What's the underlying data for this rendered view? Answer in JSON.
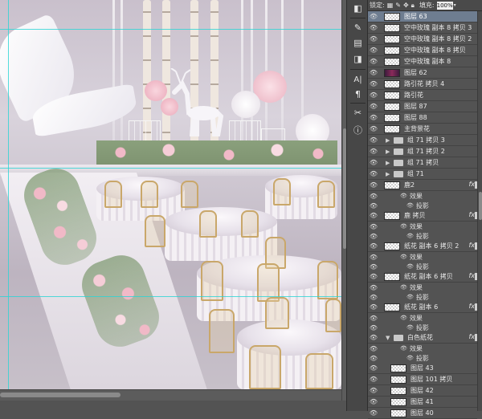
{
  "lock_bar": {
    "lock_label": "锁定:",
    "fill_label": "填充:",
    "fill_value": "100%",
    "icons": [
      "transparency-lock-icon",
      "brush-lock-icon",
      "move-lock-icon",
      "all-lock-icon"
    ]
  },
  "toolbar": {
    "icons": [
      "layers-panel-icon",
      "brush-tool-icon",
      "history-icon",
      "adjustments-icon",
      "image-icon",
      "character-icon",
      "paragraph-icon",
      "tools-icon",
      "info-icon"
    ]
  },
  "layers": [
    {
      "type": "layer",
      "name": "图层 63",
      "selected": true,
      "thumb": "blank"
    },
    {
      "type": "layer",
      "name": "空中玫瑰 副本 8 拷贝 3",
      "thumb": "blank"
    },
    {
      "type": "layer",
      "name": "空中玫瑰 副本 8 拷贝 2",
      "thumb": "blank"
    },
    {
      "type": "layer",
      "name": "空中玫瑰 副本 8 拷贝",
      "thumb": "blank"
    },
    {
      "type": "layer",
      "name": "空中玫瑰 副本 8",
      "thumb": "blank"
    },
    {
      "type": "layer",
      "name": "图层 62",
      "thumb": "dark"
    },
    {
      "type": "layer",
      "name": "路引花 拷贝 4",
      "thumb": "blank"
    },
    {
      "type": "layer",
      "name": "路引花",
      "thumb": "blank"
    },
    {
      "type": "layer",
      "name": "图层 87",
      "thumb": "blank"
    },
    {
      "type": "layer",
      "name": "图层 88",
      "thumb": "blank"
    },
    {
      "type": "layer",
      "name": "主背景花",
      "thumb": "blank"
    },
    {
      "type": "group",
      "name": "组 71 拷贝 3"
    },
    {
      "type": "group",
      "name": "组 71 拷贝 2"
    },
    {
      "type": "group",
      "name": "组 71 拷贝"
    },
    {
      "type": "group",
      "name": "组 71"
    },
    {
      "type": "layer",
      "name": "鹿2",
      "fx": "fx",
      "thumb": "blank"
    },
    {
      "type": "sub",
      "name": "效果",
      "indent": 1
    },
    {
      "type": "sub",
      "name": "投影",
      "indent": 2
    },
    {
      "type": "layer",
      "name": "鹿 拷贝",
      "fx": "fx",
      "thumb": "blank"
    },
    {
      "type": "sub",
      "name": "效果",
      "indent": 1
    },
    {
      "type": "sub",
      "name": "投影",
      "indent": 2
    },
    {
      "type": "layer",
      "name": "纸花 副本 6 拷贝 2",
      "fx": "fx",
      "thumb": "blank"
    },
    {
      "type": "sub",
      "name": "效果",
      "indent": 1
    },
    {
      "type": "sub",
      "name": "投影",
      "indent": 2
    },
    {
      "type": "layer",
      "name": "纸花 副本 6 拷贝",
      "fx": "fx",
      "thumb": "blank"
    },
    {
      "type": "sub",
      "name": "效果",
      "indent": 1
    },
    {
      "type": "sub",
      "name": "投影",
      "indent": 2
    },
    {
      "type": "layer",
      "name": "纸花 副本 6",
      "fx": "fx",
      "thumb": "blank"
    },
    {
      "type": "sub",
      "name": "效果",
      "indent": 1
    },
    {
      "type": "sub",
      "name": "投影",
      "indent": 2
    },
    {
      "type": "group-open",
      "name": "白色纸花",
      "fx": "fx"
    },
    {
      "type": "sub",
      "name": "效果",
      "indent": 1
    },
    {
      "type": "sub",
      "name": "投影",
      "indent": 2
    },
    {
      "type": "layer",
      "name": "图层 43",
      "indent": 1,
      "thumb": "blank"
    },
    {
      "type": "layer",
      "name": "图层 101 拷贝",
      "indent": 1,
      "thumb": "blank"
    },
    {
      "type": "layer",
      "name": "图层 42",
      "indent": 1,
      "thumb": "blank"
    },
    {
      "type": "layer",
      "name": "图层 41",
      "indent": 1,
      "thumb": "blank"
    },
    {
      "type": "layer",
      "name": "图层 40",
      "indent": 1,
      "thumb": "blank"
    }
  ],
  "colors": {
    "guide": "#29d4d4",
    "selected_row": "#6e7d90",
    "panel_bg": "#535353",
    "chair_gold": "#c9a76a",
    "flower_pink": "#f1b9c7"
  }
}
